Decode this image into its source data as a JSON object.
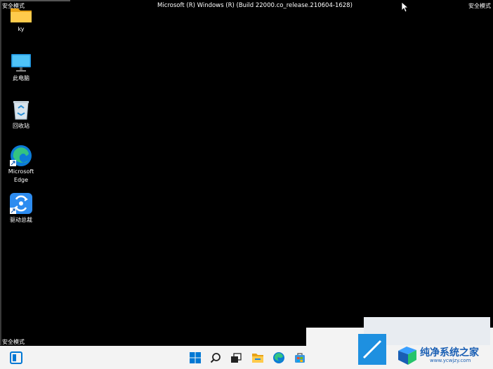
{
  "window": {
    "build_text": "Microsoft (R) Windows (R) (Build 22000.co_release.210604-1628)",
    "safe_mode_top_left": "安全模式",
    "safe_mode_top_right": "安全模式",
    "safe_mode_bottom_left": "安全模式"
  },
  "desktop_icons": [
    {
      "label": "ky",
      "icon": "folder-icon"
    },
    {
      "label": "此电脑",
      "icon": "computer-icon"
    },
    {
      "label": "回收站",
      "icon": "recycle-bin-icon"
    },
    {
      "label_line1": "Microsoft",
      "label_line2": "Edge",
      "icon": "edge-icon"
    },
    {
      "label": "驱动总裁",
      "icon": "driver-app-icon"
    }
  ],
  "taskbar": {
    "items": [
      "widgets-icon",
      "start-icon",
      "search-icon",
      "task-view-icon",
      "file-explorer-icon",
      "edge-icon",
      "store-icon"
    ]
  },
  "watermark": {
    "title": "纯净系统之家",
    "url": "www.ycwjzy.com"
  },
  "colors": {
    "desktop": "#000000",
    "taskbar": "#f3f3f3",
    "accent": "#0078d4"
  }
}
